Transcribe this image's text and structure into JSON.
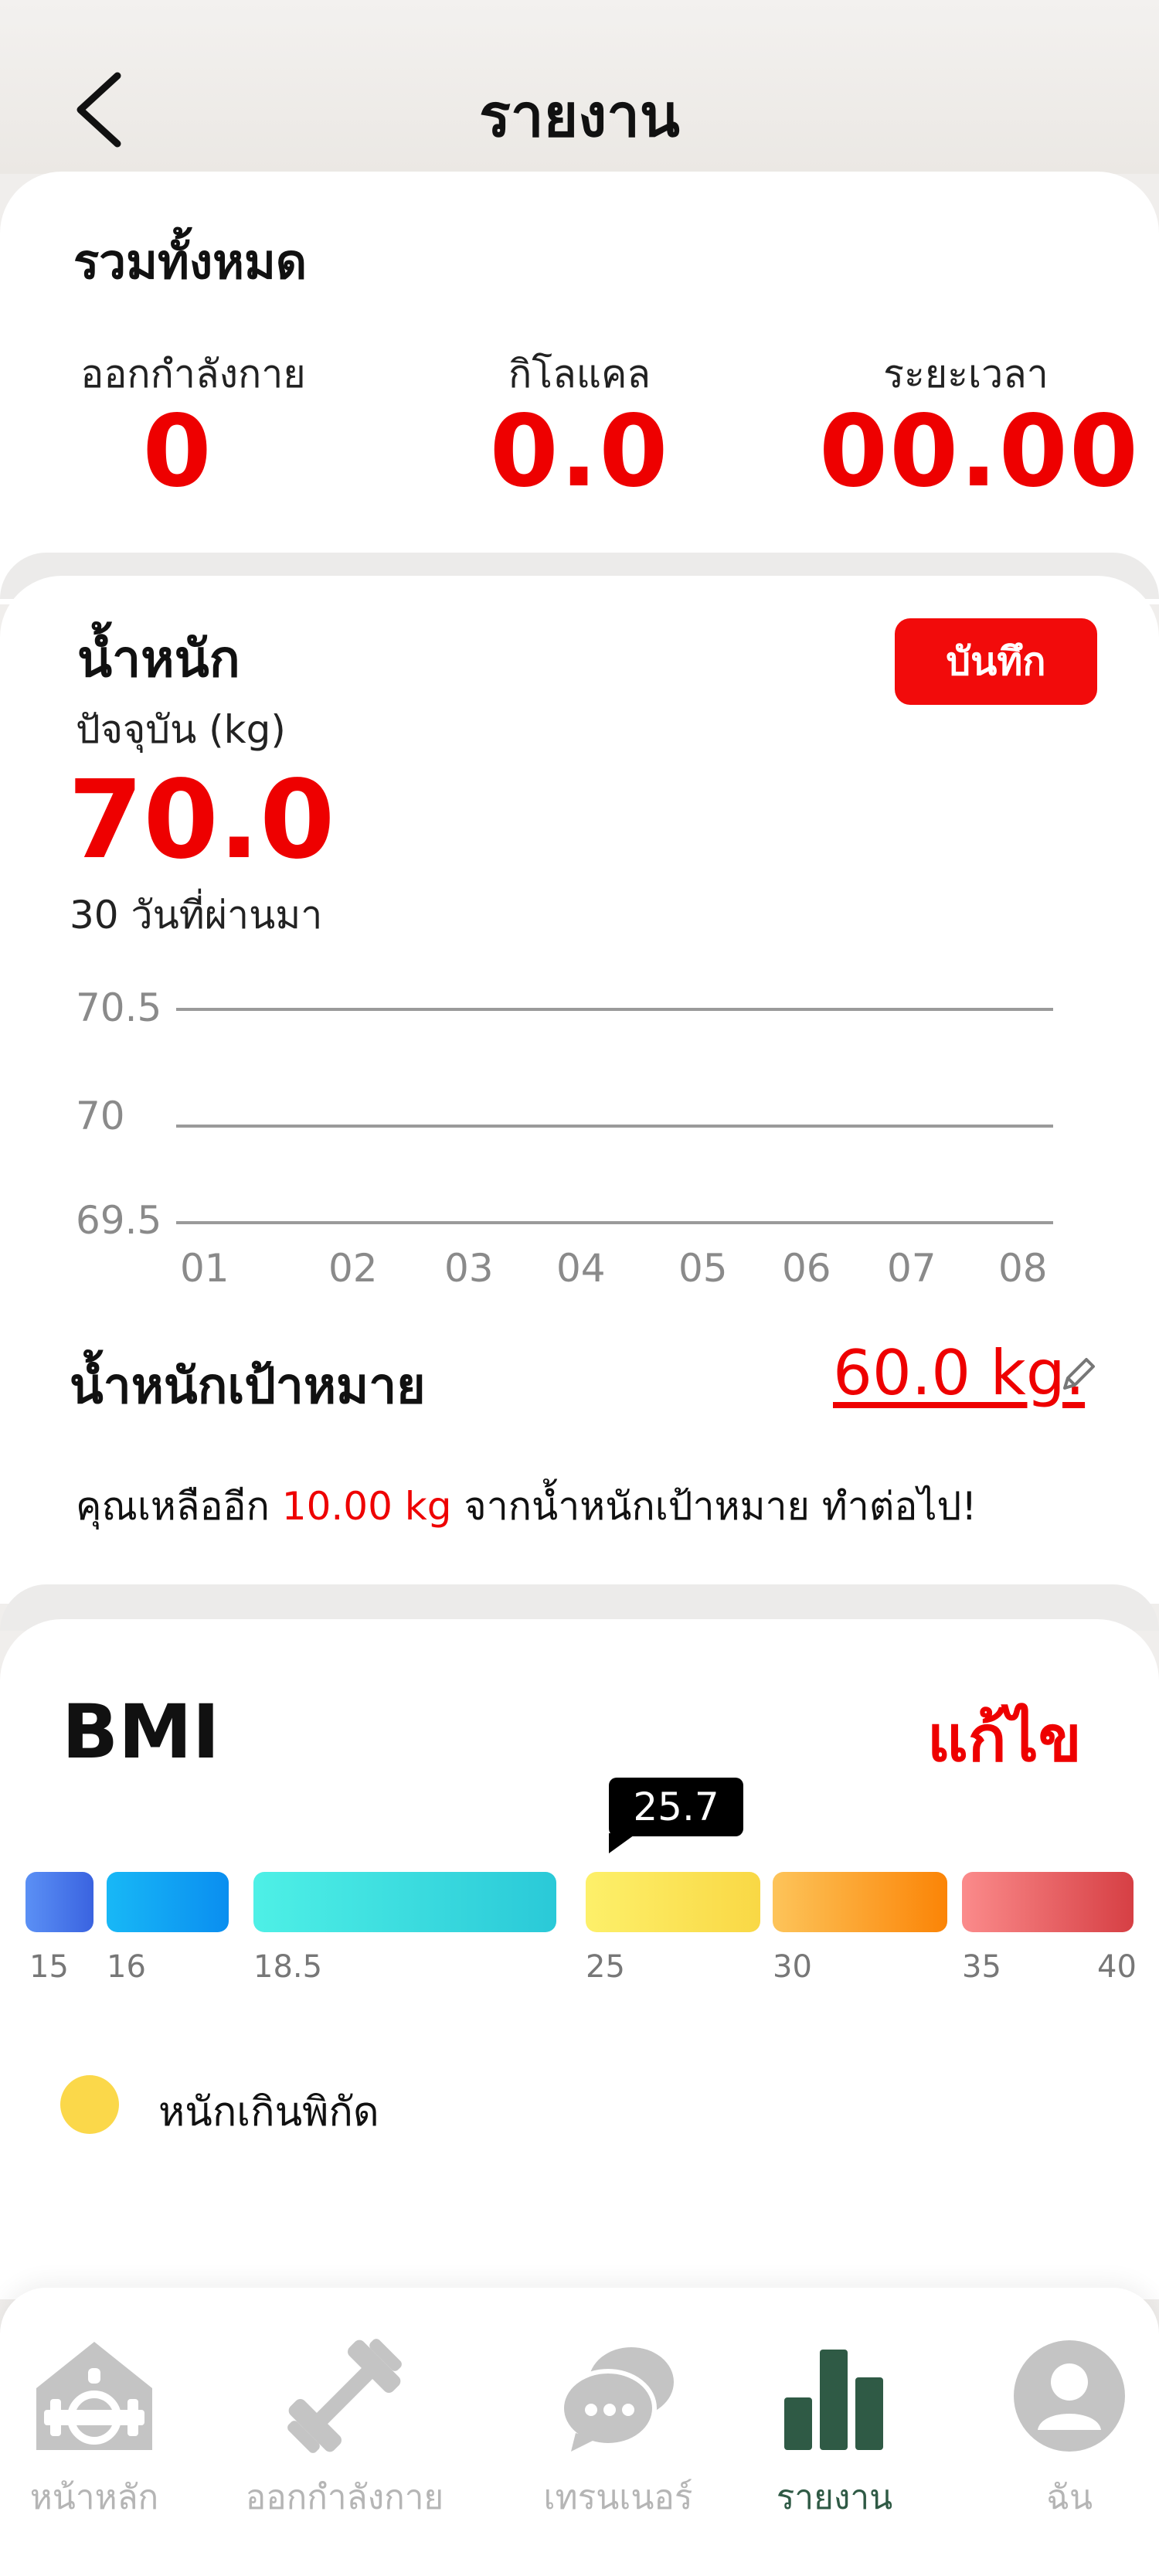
{
  "header": {
    "title": "รายงาน"
  },
  "summary": {
    "title": "รวมทั้งหมด",
    "stats": [
      {
        "label": "ออกกำลังกาย",
        "value": "0"
      },
      {
        "label": "กิโลแคล",
        "value": "0.0"
      },
      {
        "label": "ระยะเวลา",
        "value": "00.00"
      }
    ]
  },
  "weight": {
    "title": "น้ำหนัก",
    "save_label": "บันทึก",
    "current_label": "ปัจจุบัน (kg)",
    "current_value": "70.0",
    "period_label": "30 วันที่ผ่านมา",
    "goal_title": "น้ำหนักเป้าหมาย",
    "goal_value": "60.0 kg.",
    "message_prefix": "คุณเหลืออีก",
    "message_amount": "10.00 kg",
    "message_suffix": "จากน้ำหนักเป้าหมาย ทำต่อไป!"
  },
  "chart_data": {
    "type": "line",
    "x": [
      "01",
      "02",
      "03",
      "04",
      "05",
      "06",
      "07",
      "08"
    ],
    "yticks": [
      "70.5",
      "70",
      "69.5"
    ],
    "series": [],
    "grid": true
  },
  "bmi": {
    "title": "BMI",
    "edit_label": "แก้ไข",
    "value": "25.7",
    "ticks": [
      "15",
      "16",
      "18.5",
      "25",
      "30",
      "35",
      "40"
    ],
    "status_label": "หนักเกินพิกัด",
    "colors": {
      "seg1": "#4a7be8",
      "seg2": "#16a7f0",
      "seg3": "#33d6d6",
      "seg4": "#fbe04a",
      "seg5": "#fb9a1e",
      "seg6": "#e0474a",
      "status": "#fbd84a"
    }
  },
  "nav": {
    "items": [
      {
        "label": "หน้าหลัก",
        "icon": "gym-home-icon"
      },
      {
        "label": "ออกกำลังกาย",
        "icon": "dumbbell-icon"
      },
      {
        "label": "เทรนเนอร์",
        "icon": "chat-bubbles-icon"
      },
      {
        "label": "รายงาน",
        "icon": "bar-chart-icon"
      },
      {
        "label": "ฉัน",
        "icon": "user-icon"
      }
    ],
    "active_color": "#2f5a45"
  }
}
